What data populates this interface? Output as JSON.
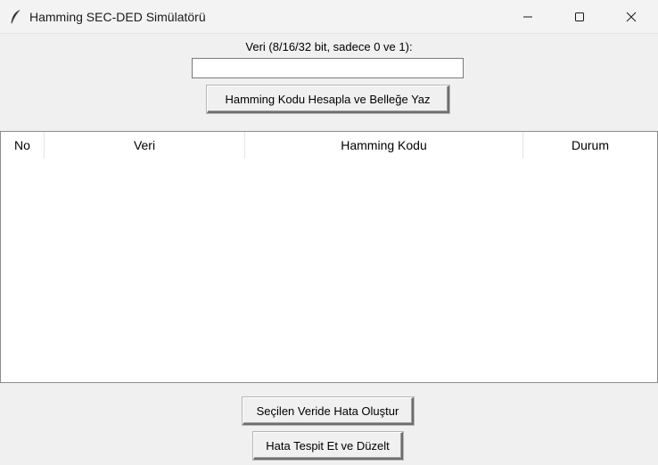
{
  "window": {
    "title": "Hamming SEC-DED Simülatörü",
    "app_icon": "feather-icon",
    "controls": [
      "minimize-icon",
      "maximize-icon",
      "close-icon"
    ]
  },
  "input": {
    "label": "Veri (8/16/32 bit, sadece 0 ve 1):",
    "value": "",
    "placeholder": ""
  },
  "buttons": {
    "compute": "Hamming Kodu Hesapla ve Belleğe Yaz",
    "inject_error": "Seçilen Veride Hata Oluştur",
    "detect_correct": "Hata Tespit Et ve Düzelt"
  },
  "table": {
    "columns": [
      "No",
      "Veri",
      "Hamming Kodu",
      "Durum"
    ],
    "rows": []
  }
}
